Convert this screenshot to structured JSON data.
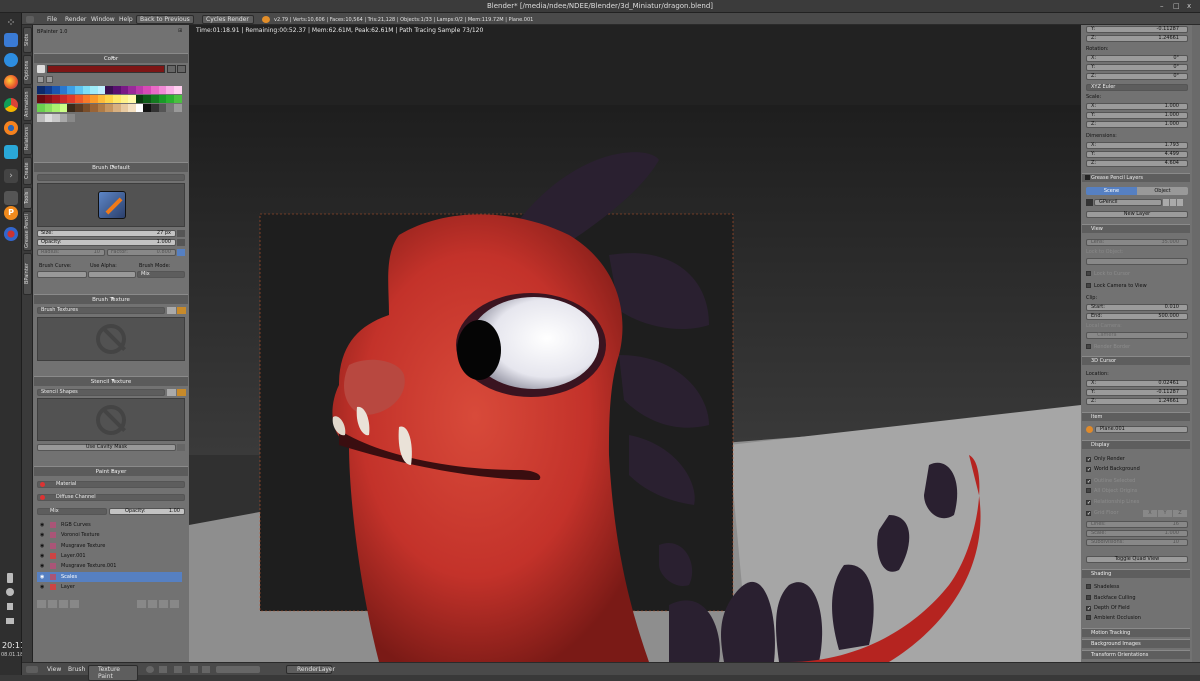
{
  "window": {
    "title": "Blender* [/media/ndee/NDEE/Blender/3d_Miniatur/dragon.blend]",
    "close_label": "x",
    "max_label": "□",
    "min_label": "–"
  },
  "menubar": {
    "items": [
      "File",
      "Render",
      "Window",
      "Help"
    ],
    "back_button": "Back to Previous",
    "engine": "Cycles Render",
    "stats": "v2.79 | Verts:10,606 | Faces:10,564 | Tris:21,128 | Objects:1/33 | Lamps:0/2 | Mem:119.72M | Plane.001"
  },
  "taskbar": {
    "time": "20:11",
    "date": "08.01.18"
  },
  "vertical_tabs": [
    "BPainter",
    "Grease Pencil",
    "Tools",
    "Create",
    "Relations",
    "Animation",
    "Options",
    "Slots"
  ],
  "left_panel": {
    "header": "BPainter 1.0",
    "color": {
      "header": "Color",
      "value": "#7d1515"
    },
    "palette": [
      "#0d2a6b",
      "#123a8e",
      "#1a55b0",
      "#2a78d0",
      "#3ea0e6",
      "#5ec4f0",
      "#7edef6",
      "#a0ecf8",
      "#c0f0ff",
      "#3a0f50",
      "#5a1070",
      "#7a1a86",
      "#9a2a9a",
      "#ba3aaa",
      "#d64ab6",
      "#e86ac6",
      "#f08ad6",
      "#f8b0e6",
      "#ffd0f0",
      "#6a0a10",
      "#8a1018",
      "#aa1820",
      "#ca2828",
      "#e03a2a",
      "#f05a2a",
      "#f87a2a",
      "#fa9a2a",
      "#fcba3a",
      "#fdd44a",
      "#fee86a",
      "#fff28a",
      "#fffaaa",
      "#0a3a10",
      "#0e5a18",
      "#147a20",
      "#1a9a28",
      "#2ab030",
      "#4ac040",
      "#6ad050",
      "#8ae060",
      "#aaf070",
      "#ccff88",
      "#3a2a1a",
      "#5a3a22",
      "#7a4e2a",
      "#9a6436",
      "#b07c46",
      "#c69660",
      "#d8b080",
      "#e8caa0",
      "#f4e0c0",
      "#ffffff",
      "#111111",
      "#333333",
      "#555555",
      "#777777",
      "#999999",
      "#bbbbbb",
      "#dddddd",
      "#c8c8c8",
      "#a8a8a8",
      "#888888"
    ],
    "brush": {
      "header": "Brush Default",
      "size_label": "Size:",
      "size_value": "27 px",
      "opacity_label": "Opacity:",
      "opacity_value": "1.000",
      "radius_label": "Radius:",
      "radius_value": "10",
      "factor_label": "Factor:",
      "factor_value": "0.800",
      "curve_label": "Brush Curve:",
      "alpha_label": "Use Alpha:",
      "mode_label": "Brush Mode:",
      "mode_value": "Mix"
    },
    "brush_texture": {
      "header": "Brush Texture",
      "select": "Brush Textures"
    },
    "stencil": {
      "header": "Stencil Texture",
      "select": "Stencil Shapes",
      "cavity_button": "Use Cavity Mask"
    },
    "paint_layer": {
      "header": "Paint Layer",
      "material": "Material",
      "channel": "Diffuse Channel",
      "blend": "Mix",
      "opacity_label": "Opacity:",
      "opacity_value": "1.00"
    },
    "layers": [
      "RGB Curves",
      "Voronoi Texture",
      "Musgrave Texture",
      "Layer.001",
      "Musgrave Texture.001",
      "Scales",
      "Layer"
    ]
  },
  "viewport": {
    "status": "Time:01:18.91 | Remaining:00:52.37 | Mem:62.61M, Peak:62.61M | Path Tracing Sample 73/120"
  },
  "right_panel": {
    "loc": [
      {
        "k": "Y:",
        "v": "-0.11287"
      },
      {
        "k": "Z:",
        "v": "1.24661"
      }
    ],
    "rotation_label": "Rotation:",
    "rotation": [
      {
        "k": "X:",
        "v": "0°"
      },
      {
        "k": "Y:",
        "v": "0°"
      },
      {
        "k": "Z:",
        "v": "0°"
      }
    ],
    "euler": "XYZ Euler",
    "scale_label": "Scale:",
    "scale": [
      {
        "k": "X:",
        "v": "1.000"
      },
      {
        "k": "Y:",
        "v": "1.000"
      },
      {
        "k": "Z:",
        "v": "1.000"
      }
    ],
    "dimensions_label": "Dimensions:",
    "dimensions": [
      {
        "k": "X:",
        "v": "1.793"
      },
      {
        "k": "Y:",
        "v": "4.499"
      },
      {
        "k": "Z:",
        "v": "4.604"
      }
    ],
    "gp_header": "Grease Pencil Layers",
    "gp_scene": "Scene",
    "gp_object": "Object",
    "gp_name": "GPencil",
    "gp_new_layer": "New Layer",
    "view_header": "View",
    "lens_label": "Lens:",
    "lens_value": "35.000",
    "lock_object": "Lock to Object:",
    "lock_cursor": "Lock to Cursor",
    "lock_camera": "Lock Camera to View",
    "clip_label": "Clip:",
    "clip_start_label": "Start:",
    "clip_start": "0.010",
    "clip_end_label": "End:",
    "clip_end": "500.000",
    "local_camera": "Local Camera:",
    "camera": "Camera",
    "render_border": "Render Border",
    "cursor_header": "3D Cursor",
    "location_label": "Location:",
    "cursor": [
      {
        "k": "X:",
        "v": "0.02461"
      },
      {
        "k": "Y:",
        "v": "-0.11287"
      },
      {
        "k": "Z:",
        "v": "1.24661"
      }
    ],
    "item_header": "Item",
    "item_name": "Plane.001",
    "display_header": "Display",
    "only_render": "Only Render",
    "world_bg": "World Background",
    "outline": "Outline Selected",
    "all_origins": "All Object Origins",
    "rel_lines": "Relationship Lines",
    "grid_floor": "Grid Floor",
    "grid_x": "X",
    "grid_y": "Y",
    "grid_z": "Z",
    "lines_label": "Lines:",
    "lines_value": "16",
    "scale_label2": "Scale:",
    "scale_value": "1.000",
    "subdiv_label": "Subdivisions:",
    "subdiv_value": "10",
    "quad_button": "Toggle Quad View",
    "shading_header": "Shading",
    "shadeless": "Shadeless",
    "backface": "Backface Culling",
    "depth": "Depth Of Field",
    "ao": "Ambient Occlusion",
    "motion": "Motion Tracking",
    "bg_images": "Background Images",
    "transform_orient": "Transform Orientations"
  },
  "bottombar": {
    "view": "View",
    "brush": "Brush",
    "mode": "Texture Paint",
    "layer": "RenderLayer"
  }
}
